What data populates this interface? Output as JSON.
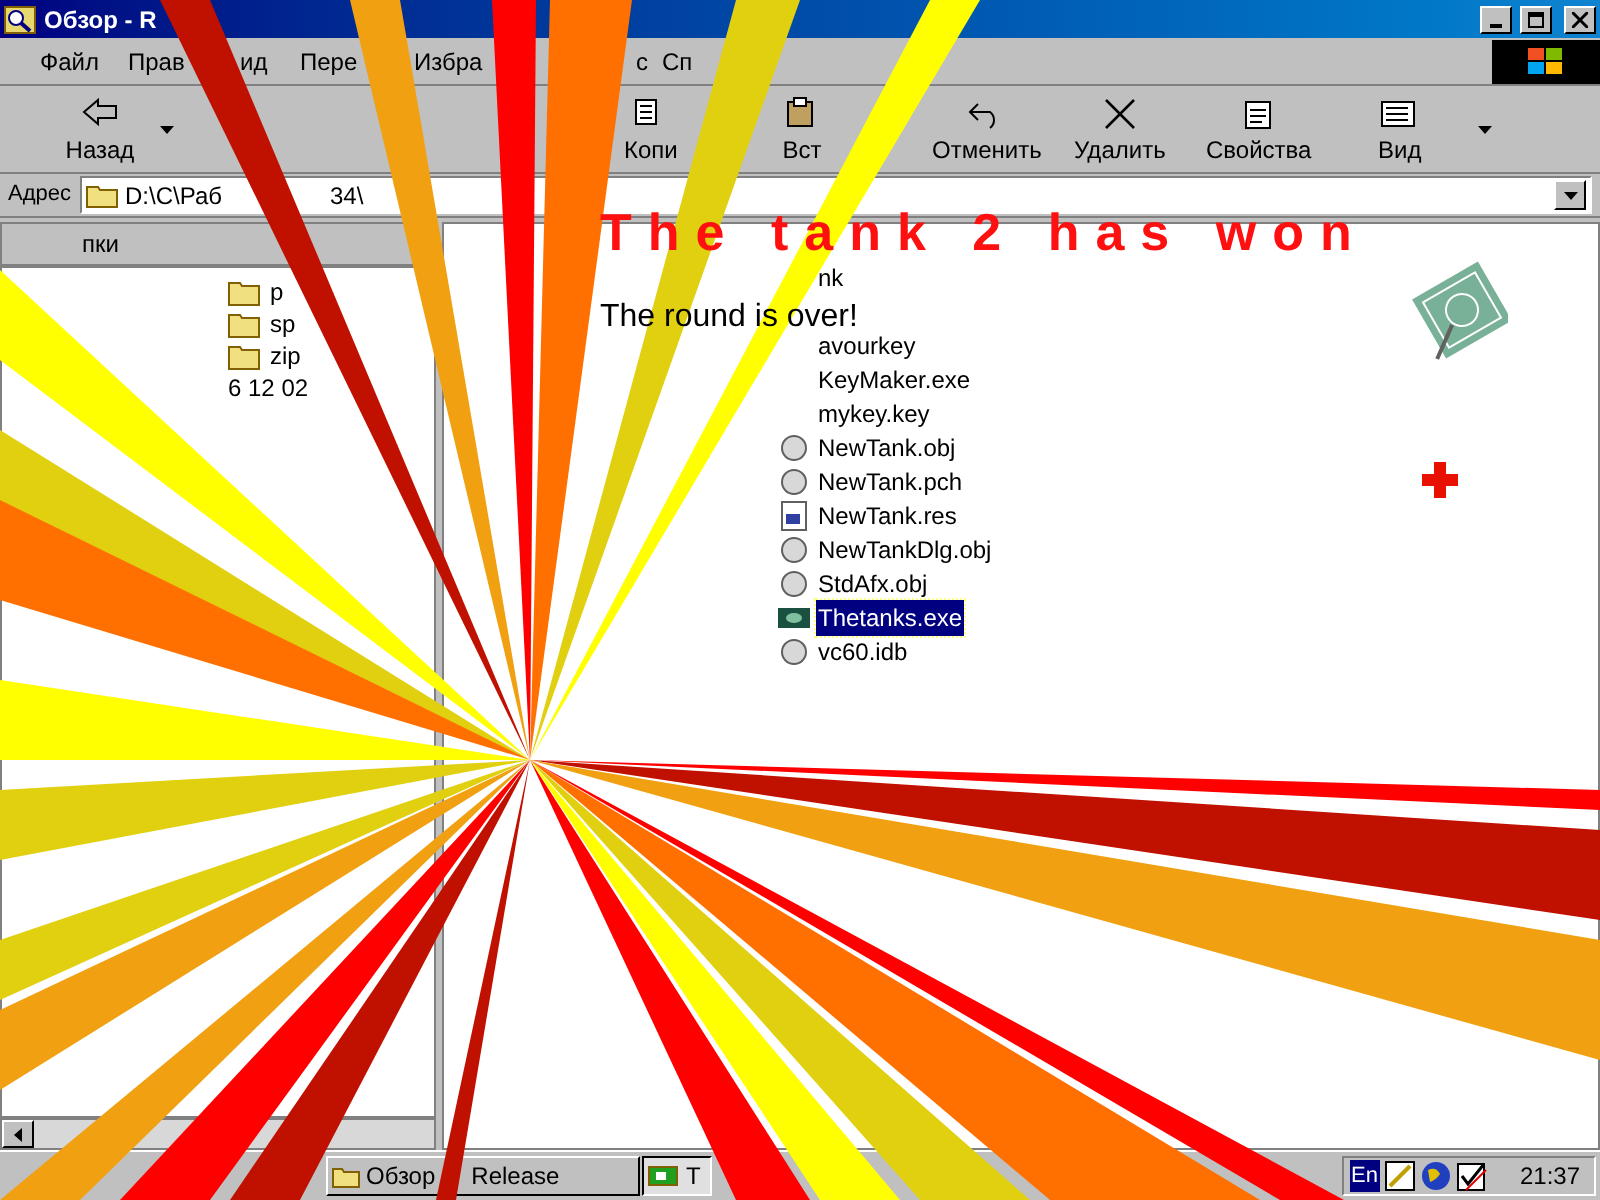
{
  "window": {
    "title": "Обзор - R"
  },
  "menu": [
    "Файл",
    "Прав",
    "ид",
    "Пере",
    "Избра",
    "с",
    "Сп"
  ],
  "toolbar": [
    {
      "kind": "back",
      "label": "Назад"
    },
    {
      "kind": "copy",
      "label": "Копи"
    },
    {
      "kind": "paste",
      "label": "Вст"
    },
    {
      "kind": "undo",
      "label": "Отменить"
    },
    {
      "kind": "delete",
      "label": "Удалить"
    },
    {
      "kind": "properties",
      "label": "Свойства"
    },
    {
      "kind": "view",
      "label": "Вид"
    }
  ],
  "address": {
    "label": "Адрес",
    "path": "D:\\C\\Раб",
    "path_tail": "34\\"
  },
  "folders": {
    "header": "пки",
    "items": [
      {
        "kind": "folder",
        "label": "p"
      },
      {
        "kind": "folder",
        "label": "sp"
      },
      {
        "kind": "folder",
        "label": "zip"
      },
      {
        "kind": "text",
        "label": "6 12 02"
      }
    ]
  },
  "files": [
    {
      "kind": "none",
      "name": "nk",
      "selected": false
    },
    {
      "kind": "none",
      "name": "avourkey",
      "selected": false
    },
    {
      "kind": "none",
      "name": "KeyMaker.exe",
      "selected": false
    },
    {
      "kind": "none",
      "name": "mykey.key",
      "selected": false
    },
    {
      "kind": "obj",
      "name": "NewTank.obj",
      "selected": false
    },
    {
      "kind": "obj",
      "name": "NewTank.pch",
      "selected": false
    },
    {
      "kind": "res",
      "name": "NewTank.res",
      "selected": false
    },
    {
      "kind": "obj",
      "name": "NewTankDlg.obj",
      "selected": false
    },
    {
      "kind": "obj",
      "name": "StdAfx.obj",
      "selected": false
    },
    {
      "kind": "exe",
      "name": "Thetanks.exe",
      "selected": true
    },
    {
      "kind": "obj",
      "name": "vc60.idb",
      "selected": false
    }
  ],
  "game": {
    "title": "The tank 2 has won",
    "message": "The round is over!"
  },
  "taskbar": {
    "tasks": [
      {
        "label": "Обзор",
        "tail": "Release",
        "selected": false
      },
      {
        "label": "T",
        "selected": true
      }
    ],
    "tray": {
      "language": "En",
      "clock": "21:37"
    }
  }
}
